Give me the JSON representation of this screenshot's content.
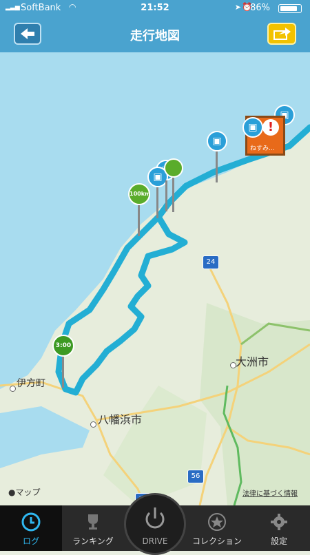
{
  "status": {
    "carrier": "SoftBank",
    "time": "21:52",
    "battery": "86%"
  },
  "nav": {
    "title": "走行地図"
  },
  "map": {
    "labels": {
      "iyo_town": "伊方町",
      "yawatahama": "八幡浜市",
      "ozu": "大洲市",
      "route24": "24",
      "route56": "56",
      "route_bottom": "26",
      "maps_brand": "マップ",
      "legal": "法律に基づく情報"
    },
    "pins": {
      "p100": "100km",
      "p300": "3:00",
      "balloon": "ねすみ…"
    }
  },
  "tabs": {
    "log": "ログ",
    "ranking": "ランキング",
    "drive": "DRIVE",
    "collection": "コレクション",
    "settings": "設定"
  }
}
